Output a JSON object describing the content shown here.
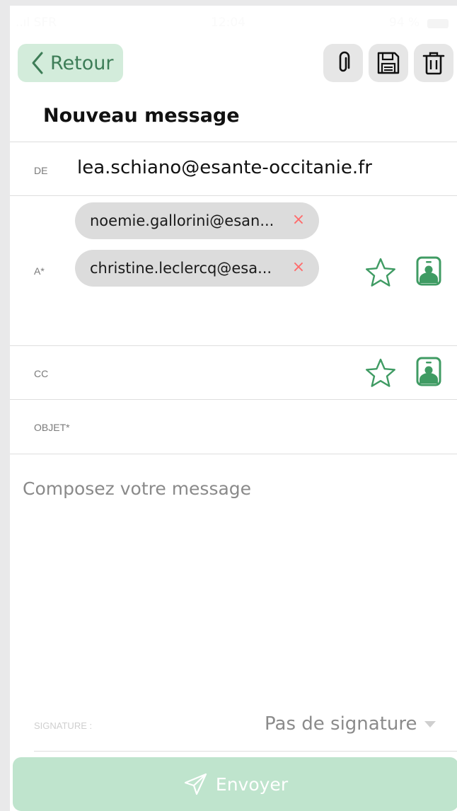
{
  "status_bar": {
    "carrier": "..ıl SFR",
    "time": "12:04",
    "battery": "94 %"
  },
  "header": {
    "back_label": "Retour",
    "title": "Nouveau message"
  },
  "form": {
    "from_label": "DE",
    "from_value": "lea.schiano@esante-occitanie.fr",
    "to_label": "A*",
    "to_chips": [
      "noemie.gallorini@esan...",
      "christine.leclercq@esa..."
    ],
    "chip_remove_symbol": "×",
    "cc_label": "CC",
    "subject_label": "OBJET*",
    "body_placeholder": "Composez votre message",
    "signature_label": "SIGNATURE :",
    "signature_value": "Pas de signature"
  },
  "actions": {
    "send_label": "Envoyer"
  },
  "icons": {
    "attach": "paperclip-icon",
    "save": "floppy-disk-icon",
    "delete": "trash-icon",
    "favorite": "star-outline-icon",
    "contacts": "contact-card-icon",
    "send": "paper-plane-icon"
  },
  "colors": {
    "accent_green": "#3f9b63",
    "back_bg": "#d3ecdb",
    "send_bg": "#bfe4cd",
    "chip_remove": "#ff6b6b"
  }
}
